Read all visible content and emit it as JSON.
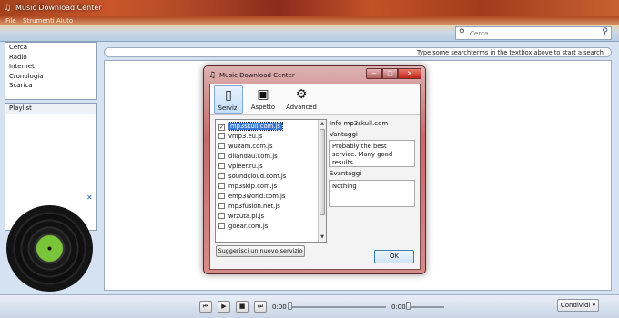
{
  "window": {
    "title": "Music Download Center",
    "app_icon": "music-note-icon"
  },
  "menu": [
    "File",
    "Strumenti",
    "Aiuto"
  ],
  "search": {
    "placeholder": "Cerca",
    "icon": "search-icon",
    "go_icon": "search-go-icon"
  },
  "nav": {
    "items": [
      "Cerca",
      "Radio",
      "Internet",
      "Cronologia",
      "Scarica"
    ]
  },
  "playlist": {
    "header": "Playlist"
  },
  "status_hint": "Type some searchterms in the textbox above to start a search",
  "player": {
    "close": "✕",
    "buttons": [
      "⏮",
      "▶",
      "■",
      "⏭"
    ],
    "time_elapsed": "0:00",
    "time_total": "0:00",
    "position_fraction": 0.0,
    "volume_fraction": 0.0
  },
  "share_button": "Condividi ▾",
  "dialog": {
    "title": "Music Download Center",
    "caption": {
      "min": "─",
      "max": "□",
      "close": "✕"
    },
    "toolbar": {
      "services": {
        "label": "Servizi",
        "icon": "phone-icon"
      },
      "appearance": {
        "label": "Aspetto",
        "icon": "monitor-icon"
      },
      "advanced": {
        "label": "Advanced",
        "icon": "gear-icon"
      }
    },
    "services": [
      {
        "name": "mp3skull.com.js",
        "checked": true,
        "selected": true
      },
      {
        "name": "vmp3.eu.js",
        "checked": false
      },
      {
        "name": "wuzam.com.js",
        "checked": false
      },
      {
        "name": "dilandau.com.js",
        "checked": false
      },
      {
        "name": "vpleer.ru.js",
        "checked": false
      },
      {
        "name": "soundcloud.com.js",
        "checked": false
      },
      {
        "name": "mp3skip.com.js",
        "checked": false
      },
      {
        "name": "emp3world.com.js",
        "checked": false
      },
      {
        "name": "mp3fusion.net.js",
        "checked": false
      },
      {
        "name": "wrzuta.pl.js",
        "checked": false
      },
      {
        "name": "goear.com.js",
        "checked": false
      }
    ],
    "suggest_button": "Suggerisci un nuovo servizio",
    "info_title": "Info mp3skull.com",
    "advantages_label": "Vantaggi",
    "advantages_text": "Probably the best service. Many good results",
    "disadvantages_label": "Svantaggi",
    "disadvantages_text": "Nothing",
    "ok_button": "OK"
  },
  "colors": {
    "accent": "#3a78d7",
    "dialog_frame": "#c46a6a",
    "vinyl_label": "#7ac43a"
  }
}
